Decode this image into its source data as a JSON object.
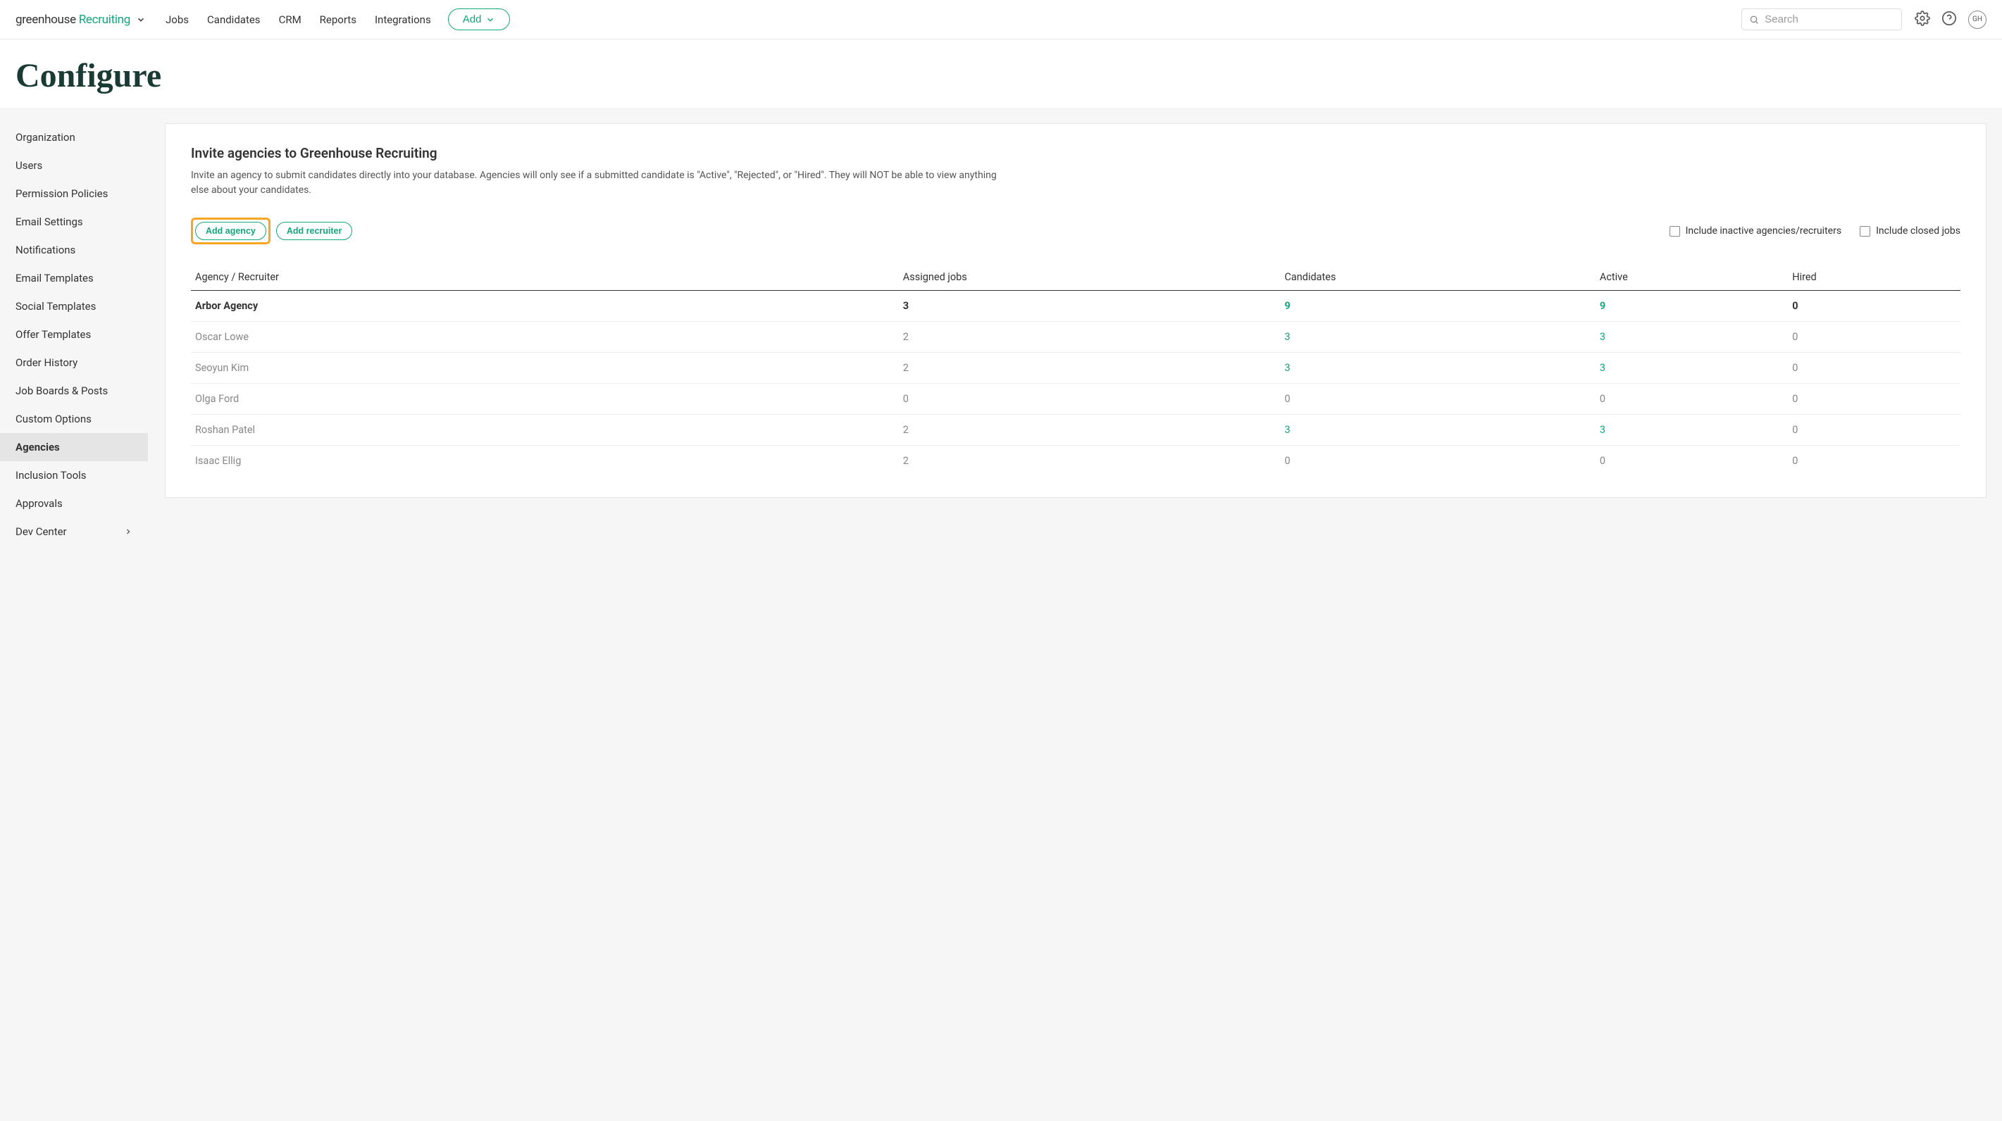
{
  "brand": {
    "left": "greenhouse",
    "right": "Recruiting"
  },
  "nav": {
    "items": [
      "Jobs",
      "Candidates",
      "CRM",
      "Reports",
      "Integrations"
    ],
    "add_label": "Add"
  },
  "search": {
    "placeholder": "Search"
  },
  "avatar": "GH",
  "page_title": "Configure",
  "sidebar": {
    "items": [
      "Organization",
      "Users",
      "Permission Policies",
      "Email Settings",
      "Notifications",
      "Email Templates",
      "Social Templates",
      "Offer Templates",
      "Order History",
      "Job Boards & Posts",
      "Custom Options",
      "Agencies",
      "Inclusion Tools",
      "Approvals",
      "Dev Center"
    ],
    "active_index": 11
  },
  "panel": {
    "title": "Invite agencies to Greenhouse Recruiting",
    "description": "Invite an agency to submit candidates directly into your database. Agencies will only see if a submitted candidate is \"Active\", \"Rejected\", or \"Hired\". They will NOT be able to view anything else about your candidates.",
    "add_agency_label": "Add agency",
    "add_recruiter_label": "Add recruiter",
    "include_inactive_label": "Include inactive agencies/recruiters",
    "include_closed_label": "Include closed jobs"
  },
  "table": {
    "headers": [
      "Agency / Recruiter",
      "Assigned jobs",
      "Candidates",
      "Active",
      "Hired"
    ],
    "rows": [
      {
        "name": "Arbor Agency",
        "assigned": "3",
        "candidates": "9",
        "active": "9",
        "hired": "0",
        "bold": true,
        "c_green": true,
        "a_green": true
      },
      {
        "name": "Oscar Lowe",
        "assigned": "2",
        "candidates": "3",
        "active": "3",
        "hired": "0",
        "muted": true,
        "c_green": true,
        "a_green": true
      },
      {
        "name": "Seoyun Kim",
        "assigned": "2",
        "candidates": "3",
        "active": "3",
        "hired": "0",
        "muted": true,
        "c_green": true,
        "a_green": true
      },
      {
        "name": "Olga Ford",
        "assigned": "0",
        "candidates": "0",
        "active": "0",
        "hired": "0",
        "muted": true
      },
      {
        "name": "Roshan Patel",
        "assigned": "2",
        "candidates": "3",
        "active": "3",
        "hired": "0",
        "muted": true,
        "c_green": true,
        "a_green": true
      },
      {
        "name": "Isaac Ellig",
        "assigned": "2",
        "candidates": "0",
        "active": "0",
        "hired": "0",
        "muted": true
      }
    ]
  }
}
